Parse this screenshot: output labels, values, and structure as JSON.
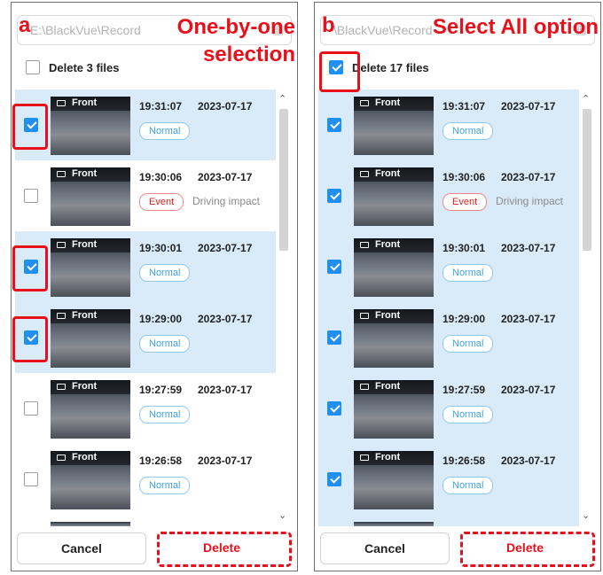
{
  "accent": "#e8111b",
  "select_color": "#1f8ff0",
  "panels": [
    {
      "letter": "a",
      "caption": "One-by-one selection",
      "path": "E:\\BlackVue\\Record",
      "delete_count_label": "Delete 3 files",
      "all_checked": false,
      "rows": [
        {
          "camera": "Front",
          "time": "19:31:07",
          "date": "2023-07-17",
          "badge": "Normal",
          "note": "",
          "checked": true
        },
        {
          "camera": "Front",
          "time": "19:30:06",
          "date": "2023-07-17",
          "badge": "Event",
          "note": "Driving impact",
          "checked": false
        },
        {
          "camera": "Front",
          "time": "19:30:01",
          "date": "2023-07-17",
          "badge": "Normal",
          "note": "",
          "checked": true
        },
        {
          "camera": "Front",
          "time": "19:29:00",
          "date": "2023-07-17",
          "badge": "Normal",
          "note": "",
          "checked": true
        },
        {
          "camera": "Front",
          "time": "19:27:59",
          "date": "2023-07-17",
          "badge": "Normal",
          "note": "",
          "checked": false
        },
        {
          "camera": "Front",
          "time": "19:26:58",
          "date": "2023-07-17",
          "badge": "Normal",
          "note": "",
          "checked": false
        }
      ],
      "cancel_label": "Cancel",
      "delete_label": "Delete"
    },
    {
      "letter": "b",
      "caption": "Select All option",
      "path": "\\BlackVue\\Record",
      "delete_count_label": "Delete 17 files",
      "all_checked": true,
      "rows": [
        {
          "camera": "Front",
          "time": "19:31:07",
          "date": "2023-07-17",
          "badge": "Normal",
          "note": "",
          "checked": true
        },
        {
          "camera": "Front",
          "time": "19:30:06",
          "date": "2023-07-17",
          "badge": "Event",
          "note": "Driving impact",
          "checked": true
        },
        {
          "camera": "Front",
          "time": "19:30:01",
          "date": "2023-07-17",
          "badge": "Normal",
          "note": "",
          "checked": true
        },
        {
          "camera": "Front",
          "time": "19:29:00",
          "date": "2023-07-17",
          "badge": "Normal",
          "note": "",
          "checked": true
        },
        {
          "camera": "Front",
          "time": "19:27:59",
          "date": "2023-07-17",
          "badge": "Normal",
          "note": "",
          "checked": true
        },
        {
          "camera": "Front",
          "time": "19:26:58",
          "date": "2023-07-17",
          "badge": "Normal",
          "note": "",
          "checked": true
        }
      ],
      "cancel_label": "Cancel",
      "delete_label": "Delete"
    }
  ]
}
